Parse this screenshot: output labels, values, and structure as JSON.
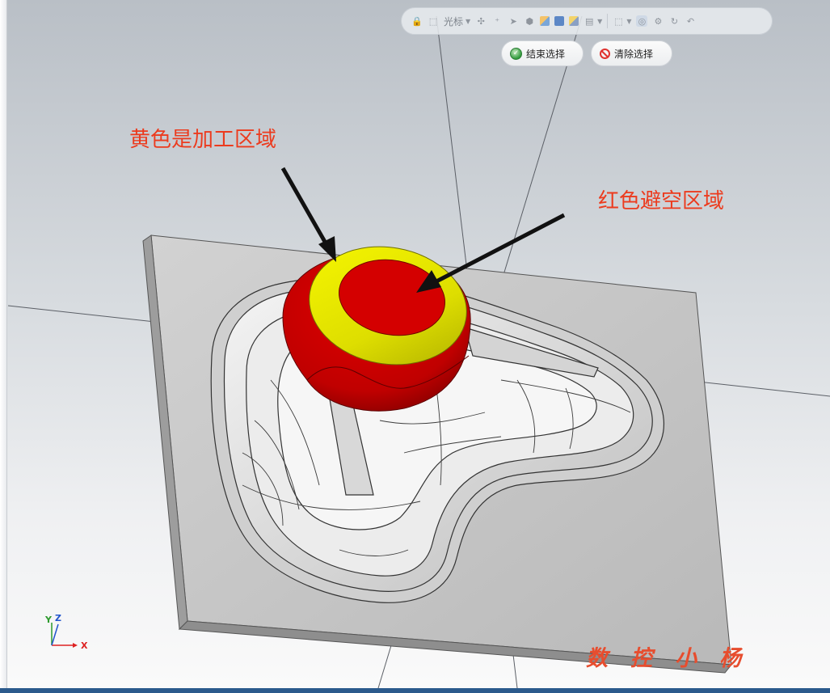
{
  "toolbar": {
    "cursor_label": "光标",
    "icons": [
      "lock-icon",
      "select-cursor-icon",
      "xyz-icon",
      "add-point-icon",
      "pointer-icon",
      "cube-group-icon",
      "cube-view-icon",
      "layer-icon",
      "rect-select-icon",
      "zoom-icon",
      "settings-icon",
      "undo-icon"
    ]
  },
  "actions": {
    "end_select": "结束选择",
    "clear_select": "清除选择"
  },
  "annotations": {
    "yellow_label": "黄色是加工区域",
    "red_label": "红色避空区域"
  },
  "axes": {
    "y": "Y",
    "z": "Z",
    "x": "X"
  },
  "watermark": "数控小杨",
  "colors": {
    "machining_area": "#e8e800",
    "avoid_area": "#d40000",
    "annotation_text": "#ec3b1e",
    "plate": "#c4c4c4"
  }
}
